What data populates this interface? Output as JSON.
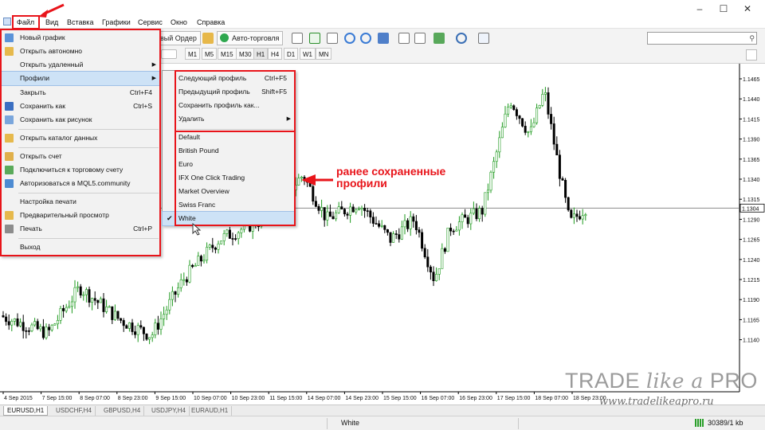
{
  "menubar": {
    "items": [
      "Файл",
      "Вид",
      "Вставка",
      "Графики",
      "Сервис",
      "Окно",
      "Справка"
    ]
  },
  "toolbar": {
    "new_order": "вый Ордер",
    "autotrade": "Авто-торговля",
    "timeframes": [
      "M1",
      "M5",
      "M15",
      "M30",
      "H1",
      "H4",
      "D1",
      "W1",
      "MN"
    ],
    "active_timeframe": "H1"
  },
  "file_menu": {
    "items": [
      {
        "label": "Новый график",
        "shortcut": "",
        "icon": "new-chart-icon"
      },
      {
        "label": "Открыть автономно",
        "shortcut": "",
        "icon": "folder-icon"
      },
      {
        "label": "Открыть удаленный",
        "shortcut": "",
        "submenu": true
      },
      {
        "label": "Профили",
        "shortcut": "",
        "submenu": true,
        "highlighted": true
      },
      {
        "label": "Закрыть",
        "shortcut": "Ctrl+F4"
      },
      {
        "label": "Сохранить как",
        "shortcut": "Ctrl+S",
        "icon": "save-icon"
      },
      {
        "label": "Сохранить как рисунок",
        "shortcut": "",
        "icon": "save-picture-icon"
      },
      {
        "label": "Открыть каталог данных",
        "shortcut": "",
        "icon": "folder-icon"
      },
      {
        "label": "Открыть счет",
        "shortcut": "",
        "icon": "account-icon"
      },
      {
        "label": "Подключиться к торговому счету",
        "shortcut": "",
        "icon": "connect-icon"
      },
      {
        "label": "Авторизоваться в MQL5.community",
        "shortcut": "",
        "icon": "mql5-icon"
      },
      {
        "label": "Настройка печати",
        "shortcut": ""
      },
      {
        "label": "Предварительный просмотр",
        "shortcut": "",
        "icon": "preview-icon"
      },
      {
        "label": "Печать",
        "shortcut": "Ctrl+P",
        "icon": "printer-icon"
      },
      {
        "label": "Выход",
        "shortcut": ""
      }
    ]
  },
  "profiles_menu": {
    "commands": [
      {
        "label": "Следующий профиль",
        "shortcut": "Ctrl+F5"
      },
      {
        "label": "Предыдущий профиль",
        "shortcut": "Shift+F5"
      },
      {
        "label": "Сохранить профиль как...",
        "shortcut": ""
      },
      {
        "label": "Удалить",
        "shortcut": "",
        "submenu": true
      }
    ],
    "profiles": [
      "Default",
      "British Pound",
      "Euro",
      "IFX One Click Trading",
      "Market Overview",
      "Swiss Franc",
      "White"
    ],
    "checked": "White"
  },
  "annotation": {
    "line1": "ранее сохраненные",
    "line2": "профили"
  },
  "chart": {
    "price_labels": [
      "1.1465",
      "1.1440",
      "1.1415",
      "1.1390",
      "1.1365",
      "1.1340",
      "1.1315",
      "1.1290",
      "1.1265",
      "1.1240",
      "1.1215",
      "1.1190",
      "1.1165",
      "1.1140"
    ],
    "current_price": "1.1304",
    "time_labels": [
      "4 Sep 2015",
      "7 Sep 15:00",
      "8 Sep 07:00",
      "8 Sep 23:00",
      "9 Sep 15:00",
      "10 Sep 07:00",
      "10 Sep 23:00",
      "11 Sep 15:00",
      "14 Sep 07:00",
      "14 Sep 23:00",
      "15 Sep 15:00",
      "16 Sep 07:00",
      "16 Sep 23:00",
      "17 Sep 15:00",
      "18 Sep 07:00",
      "18 Sep 23:00"
    ],
    "bull_color": "#1e9a1e",
    "bear_color": "#000000"
  },
  "tabs": [
    "EURUSD,H1",
    "USDCHF,H4",
    "GBPUSD,H4",
    "USDJPY,H4",
    "EURAUD,H1"
  ],
  "active_tab": "EURUSD,H1",
  "status": {
    "profile": "White",
    "traffic": "30389/1 kb"
  },
  "watermark": {
    "logo_trade": "TRADE",
    "logo_like": "like a",
    "logo_pro": "PRO",
    "url": "www.tradelikeapro.ru"
  },
  "colors": {
    "highlight": "#e8141a",
    "menu_selection": "#cde2f6"
  }
}
